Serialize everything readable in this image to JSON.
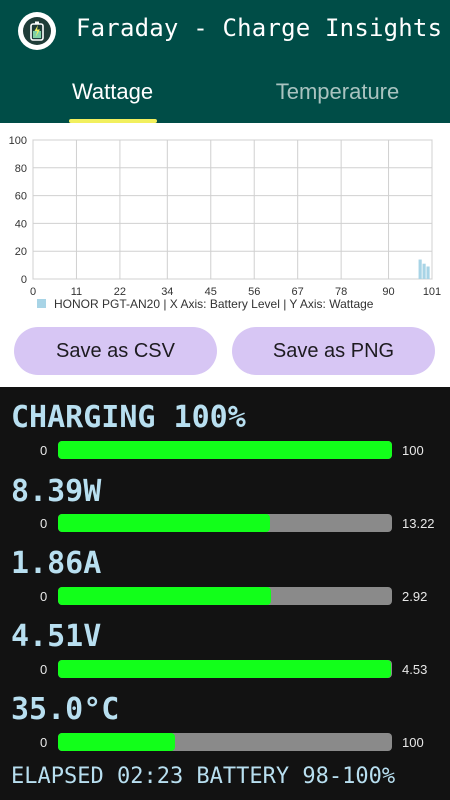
{
  "app": {
    "title": "Faraday - Charge Insights",
    "icon": "battery-charging-icon"
  },
  "tabs": [
    {
      "label": "Wattage",
      "active": true
    },
    {
      "label": "Temperature",
      "active": false
    }
  ],
  "chart_data": {
    "type": "bar",
    "title": "",
    "xlabel": "",
    "ylabel": "",
    "x_ticks": [
      "0",
      "11",
      "22",
      "34",
      "45",
      "56",
      "67",
      "78",
      "90",
      "101"
    ],
    "y_ticks": [
      "0",
      "20",
      "40",
      "60",
      "80",
      "100"
    ],
    "xlim": [
      0,
      101
    ],
    "ylim": [
      0,
      100
    ],
    "grid": true,
    "legend_position": "bottom",
    "legend": "HONOR PGT-AN20 | X Axis: Battery Level | Y Axis: Wattage",
    "series": [
      {
        "name": "HONOR PGT-AN20",
        "color": "#a8d4e6",
        "x": [
          98,
          99,
          100
        ],
        "values": [
          14,
          11,
          9
        ]
      }
    ]
  },
  "buttons": {
    "csv": "Save as CSV",
    "png": "Save as PNG"
  },
  "metrics": [
    {
      "label": "CHARGING 100%",
      "min": "0",
      "max": "100",
      "fraction": 1.0
    },
    {
      "label": "8.39W",
      "min": "0",
      "max": "13.22",
      "fraction": 0.635
    },
    {
      "label": "1.86A",
      "min": "0",
      "max": "2.92",
      "fraction": 0.637
    },
    {
      "label": "4.51V",
      "min": "0",
      "max": "4.53",
      "fraction": 0.996
    },
    {
      "label": "35.0°C",
      "min": "0",
      "max": "100",
      "fraction": 0.35
    }
  ],
  "footer": "ELAPSED 02:23 BATTERY 98-100%",
  "colors": {
    "app_bar": "#004d47",
    "tab_indicator": "#f2f05e",
    "button_bg": "#d7c6f4",
    "bar_fill": "#12ff1a",
    "bar_track": "#8a8a8a",
    "metric_text": "#b8dff0",
    "background": "#121212"
  }
}
